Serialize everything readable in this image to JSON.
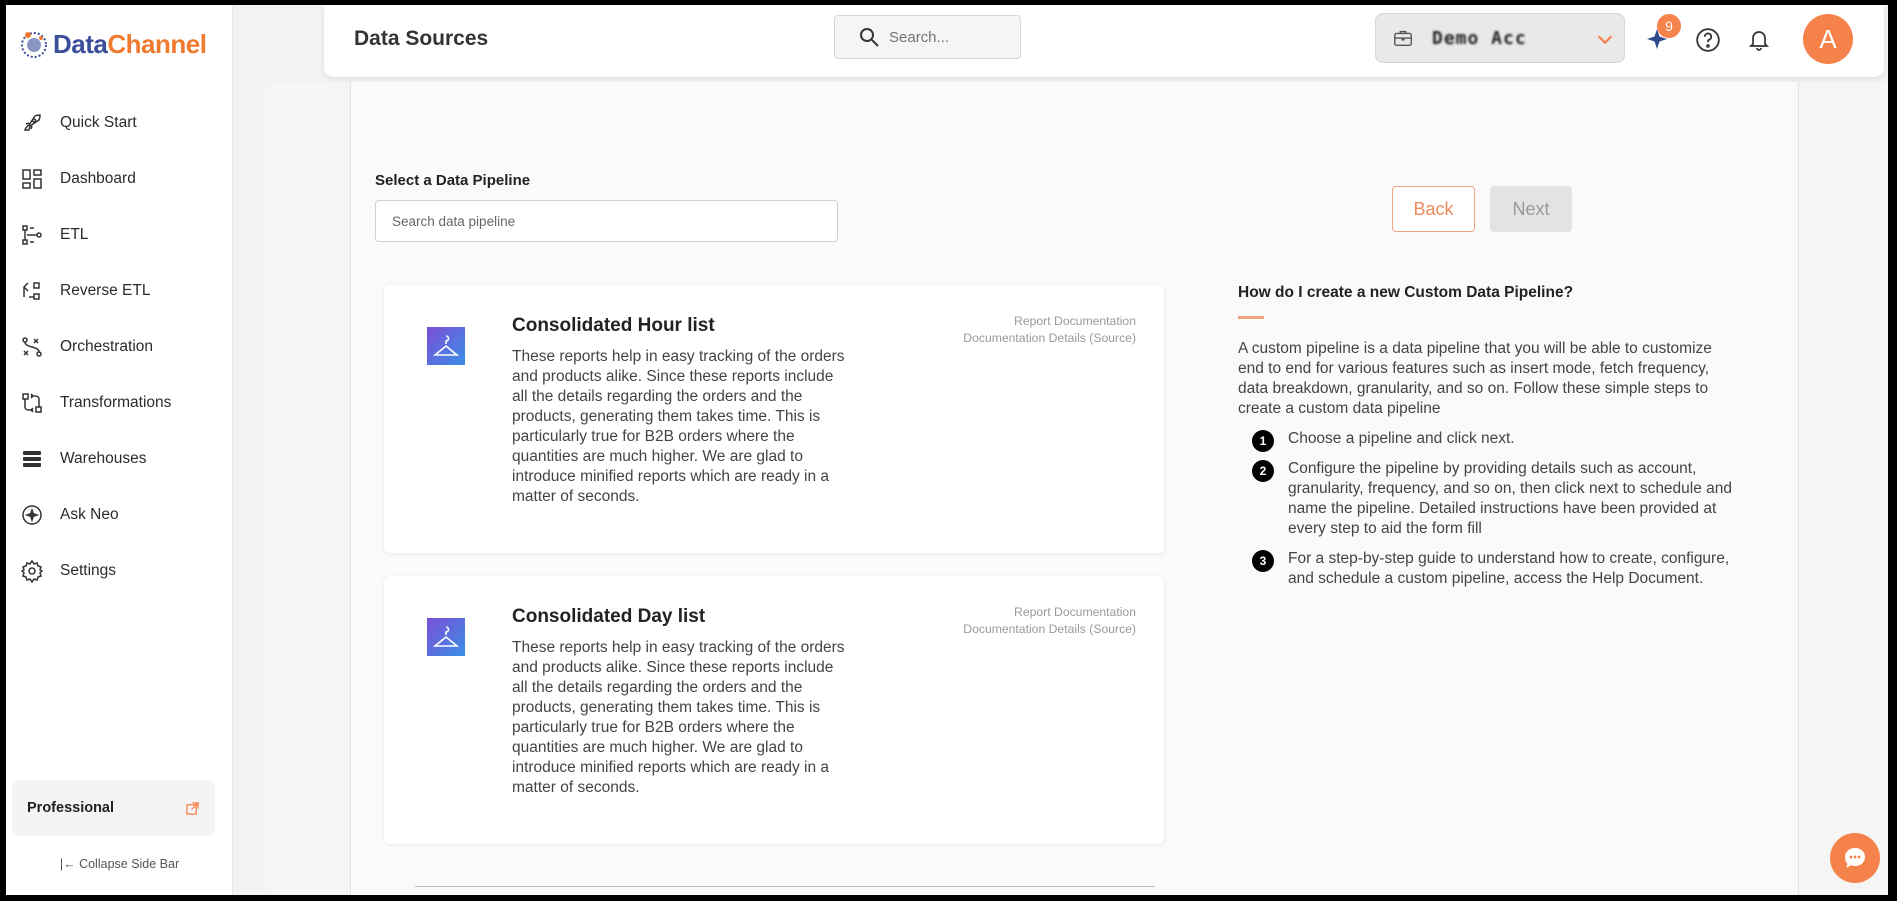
{
  "brand": {
    "name_part1": "Data",
    "name_part2": "Channel",
    "accent": "#f5824a",
    "primary": "#3a4e9a"
  },
  "sidebar": {
    "items": [
      {
        "label": "Quick Start",
        "icon": "rocket-icon"
      },
      {
        "label": "Dashboard",
        "icon": "dashboard-icon"
      },
      {
        "label": "ETL",
        "icon": "etl-icon"
      },
      {
        "label": "Reverse ETL",
        "icon": "reverse-etl-icon"
      },
      {
        "label": "Orchestration",
        "icon": "orchestration-icon"
      },
      {
        "label": "Transformations",
        "icon": "transformations-icon"
      },
      {
        "label": "Warehouses",
        "icon": "warehouses-icon"
      },
      {
        "label": "Ask Neo",
        "icon": "ask-neo-icon"
      },
      {
        "label": "Settings",
        "icon": "gear-icon"
      }
    ],
    "plan": "Professional",
    "collapse_label": "Collapse Side Bar"
  },
  "header": {
    "title": "Data Sources",
    "search_placeholder": "Search...",
    "account_name": "Demo Acc",
    "notification_count": "9",
    "avatar_initial": "A"
  },
  "main": {
    "select_label": "Select a Data Pipeline",
    "pipeline_search_placeholder": "Search data pipeline",
    "back_label": "Back",
    "next_label": "Next",
    "cards": [
      {
        "title": "Consolidated Hour list",
        "description": "These reports help in easy tracking of the orders and products alike. Since these reports include all the details regarding the orders and the products, generating them takes time. This is particularly true for B2B orders where the quantities are much higher. We are glad to introduce minified reports which are ready in a matter of seconds.",
        "link1": "Report Documentation",
        "link2": "Documentation Details (Source)"
      },
      {
        "title": "Consolidated Day list",
        "description": "These reports help in easy tracking of the orders and products alike. Since these reports include all the details regarding the orders and the products, generating them takes time. This is particularly true for B2B orders where the quantities are much higher. We are glad to introduce minified reports which are ready in a matter of seconds.",
        "link1": "Report Documentation",
        "link2": "Documentation Details (Source)"
      }
    ]
  },
  "help": {
    "title": "How do I create a new Custom Data Pipeline?",
    "body": "A custom pipeline is a data pipeline that you will be able to customize end to end for various features such as insert mode, fetch frequency, data breakdown, granularity, and so on. Follow these simple steps to create a custom data pipeline",
    "steps": [
      {
        "num": "1",
        "text": "Choose a pipeline and click next."
      },
      {
        "num": "2",
        "text": "Configure the pipeline by providing details such as account, granularity, frequency, and so on, then click next to schedule and name the pipeline. Detailed instructions have been provided at every step to aid the form fill"
      },
      {
        "num": "3",
        "text": "For a step-by-step guide to understand how to create, configure, and schedule a custom pipeline, access the Help Document."
      }
    ]
  }
}
